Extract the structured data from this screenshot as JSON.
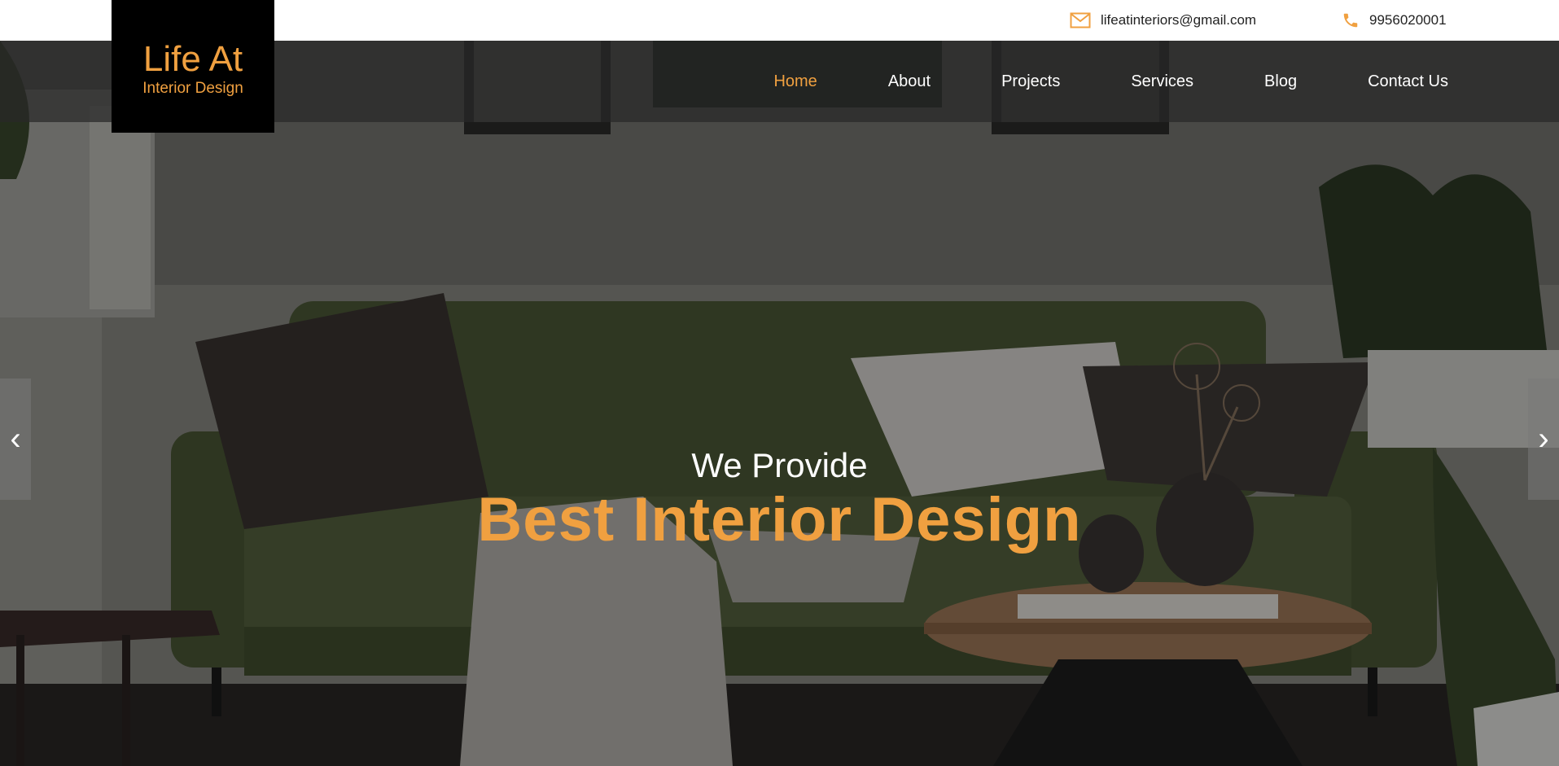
{
  "brand": {
    "name_line1": "Life At",
    "name_line2": "Interior Design",
    "accent_color": "#f0a040"
  },
  "topbar": {
    "email": "lifeatinteriors@gmail.com",
    "email_icon": "mail-icon",
    "phone": "9956020001",
    "phone_icon": "phone-icon"
  },
  "nav": {
    "items": [
      {
        "label": "Home",
        "active": true
      },
      {
        "label": "About",
        "active": false
      },
      {
        "label": "Projects",
        "active": false
      },
      {
        "label": "Services",
        "active": false
      },
      {
        "label": "Blog",
        "active": false
      },
      {
        "label": "Contact Us",
        "active": false
      }
    ]
  },
  "hero": {
    "subtitle": "We Provide",
    "title": "Best Interior Design",
    "prev_icon": "‹",
    "next_icon": "›"
  }
}
